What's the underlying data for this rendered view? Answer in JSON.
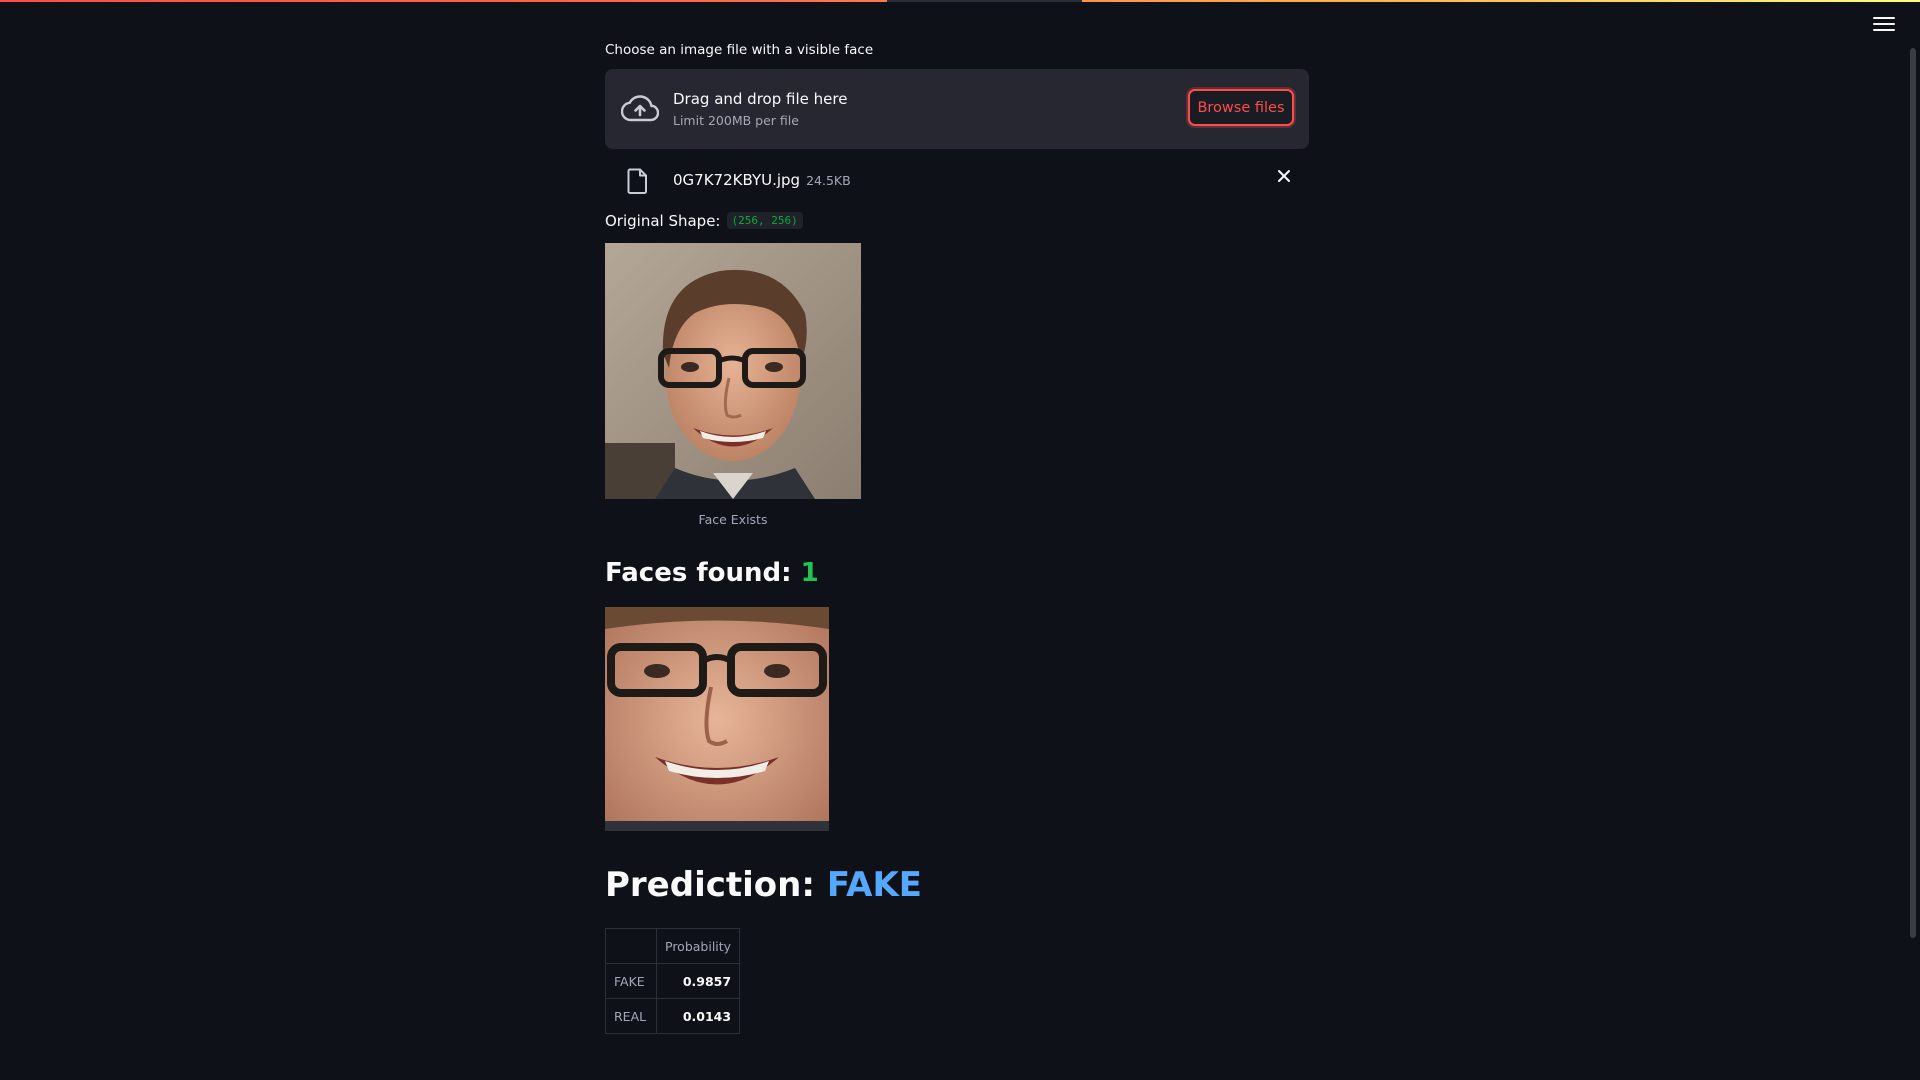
{
  "uploader": {
    "label": "Choose an image file with a visible face",
    "drop_title": "Drag and drop file here",
    "drop_limit": "Limit 200MB per file",
    "browse_label": "Browse files",
    "icon": "cloud-upload-icon"
  },
  "file": {
    "name": "0G7K72KBYU.jpg",
    "size": "24.5KB",
    "icon": "file-icon"
  },
  "shape": {
    "label": "Original Shape:",
    "value": "(256, 256)"
  },
  "original_image": {
    "caption": "Face Exists"
  },
  "faces": {
    "label": "Faces found:",
    "count": "1"
  },
  "prediction": {
    "label": "Prediction:",
    "value": "FAKE"
  },
  "table": {
    "header": "Probability",
    "rows": [
      {
        "label": "FAKE",
        "value": "0.9857"
      },
      {
        "label": "REAL",
        "value": "0.0143"
      }
    ]
  },
  "colors": {
    "accent": "#ff4b4b",
    "success": "#21c354",
    "info": "#54a8ff",
    "background": "#0e1117"
  }
}
